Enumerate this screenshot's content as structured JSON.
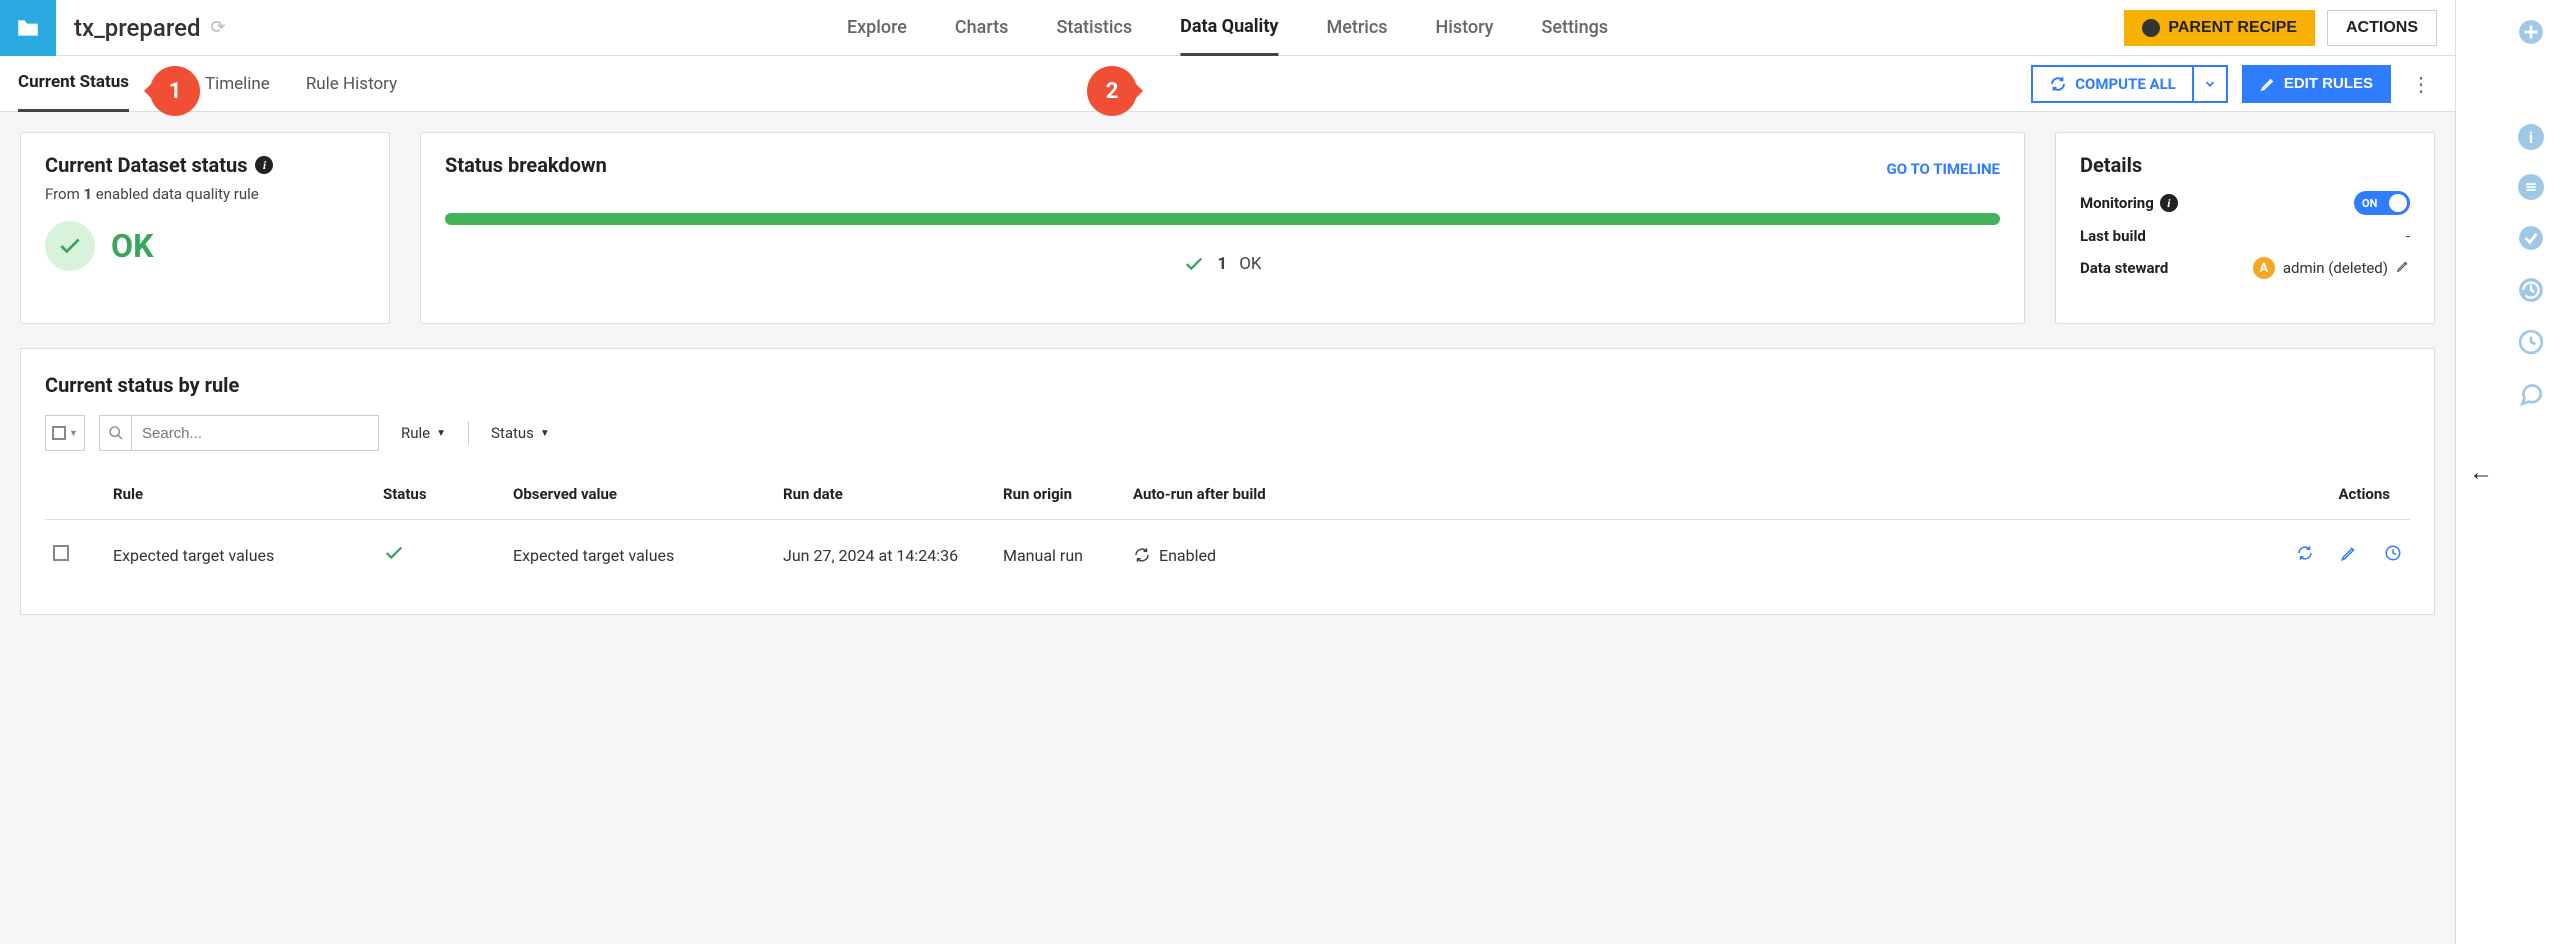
{
  "header": {
    "dataset_name": "tx_prepared",
    "tabs": [
      "Explore",
      "Charts",
      "Statistics",
      "Data Quality",
      "Metrics",
      "History",
      "Settings"
    ],
    "active_tab": "Data Quality",
    "parent_recipe_label": "PARENT RECIPE",
    "actions_label": "ACTIONS"
  },
  "subheader": {
    "tabs": [
      "Current Status",
      "Timeline",
      "Rule History"
    ],
    "active_tab": "Current Status",
    "compute_all_label": "COMPUTE ALL",
    "edit_rules_label": "EDIT RULES"
  },
  "callouts": {
    "b1": "1",
    "b2": "2"
  },
  "status_card": {
    "title": "Current Dataset status",
    "subtitle_prefix": "From ",
    "subtitle_count": "1",
    "subtitle_suffix": " enabled data quality rule",
    "status_text": "OK"
  },
  "breakdown_card": {
    "title": "Status breakdown",
    "go_link": "GO TO TIMELINE",
    "legend_count": "1",
    "legend_label": "OK"
  },
  "details_card": {
    "title": "Details",
    "monitoring_label": "Monitoring",
    "monitoring_on": "ON",
    "last_build_label": "Last build",
    "last_build_value": "-",
    "steward_label": "Data steward",
    "steward_initial": "A",
    "steward_value": "admin (deleted)"
  },
  "rules_panel": {
    "title": "Current status by rule",
    "search_placeholder": "Search...",
    "filters": {
      "rule": "Rule",
      "status": "Status"
    },
    "columns": {
      "rule": "Rule",
      "status": "Status",
      "observed": "Observed value",
      "run_date": "Run date",
      "run_origin": "Run origin",
      "auto_run": "Auto-run after build",
      "actions": "Actions"
    },
    "rows": [
      {
        "rule": "Expected target values",
        "observed": "Expected target values",
        "run_date": "Jun 27, 2024 at 14:24:36",
        "run_origin": "Manual run",
        "auto_run": "Enabled"
      }
    ]
  }
}
